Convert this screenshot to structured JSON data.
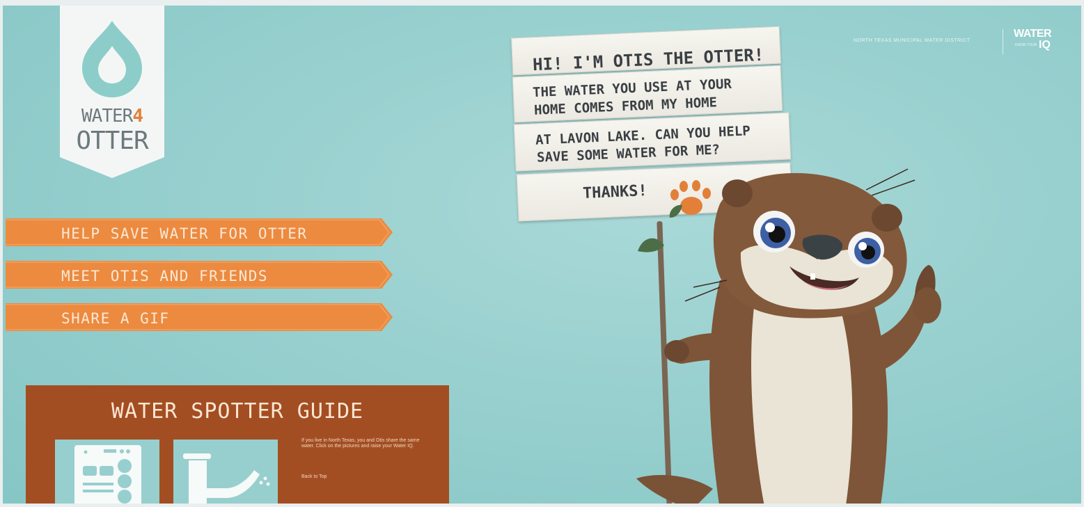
{
  "header": {
    "district": "NORTH TEXAS MUNICIPAL WATER DISTRICT",
    "water_iq_top": "WATER",
    "water_iq_bottom": "IQ",
    "water_iq_small": "KNOW YOUR"
  },
  "logo": {
    "line1": "WATER",
    "line1_accent": "4",
    "line2": "OTTER"
  },
  "nav": {
    "items": [
      {
        "label": "HELP SAVE WATER FOR OTTER"
      },
      {
        "label": "MEET OTIS AND FRIENDS"
      },
      {
        "label": "SHARE A GIF"
      }
    ]
  },
  "sign": {
    "line1": "HI! I'M OTIS THE OTTER!",
    "line2a": "THE WATER YOU USE AT YOUR",
    "line2b": "HOME COMES FROM MY HOME",
    "line3a": "AT LAVON LAKE. CAN YOU HELP",
    "line3b": "SAVE SOME WATER FOR ME?",
    "thanks": "THANKS!"
  },
  "guide": {
    "title": "WATER SPOTTER GUIDE",
    "text": "If you live in North Texas, you and Otis share the same water. Click on the pictures and raise your Water IQ.",
    "back_to_top": "Back to Top",
    "tiles": [
      {
        "icon": "dishwasher-icon"
      },
      {
        "icon": "faucet-icon"
      }
    ]
  },
  "colors": {
    "background": "#98d0cf",
    "nav_orange": "#ec8a3f",
    "guide_brown": "#a34e22",
    "accent": "#e2803a"
  }
}
